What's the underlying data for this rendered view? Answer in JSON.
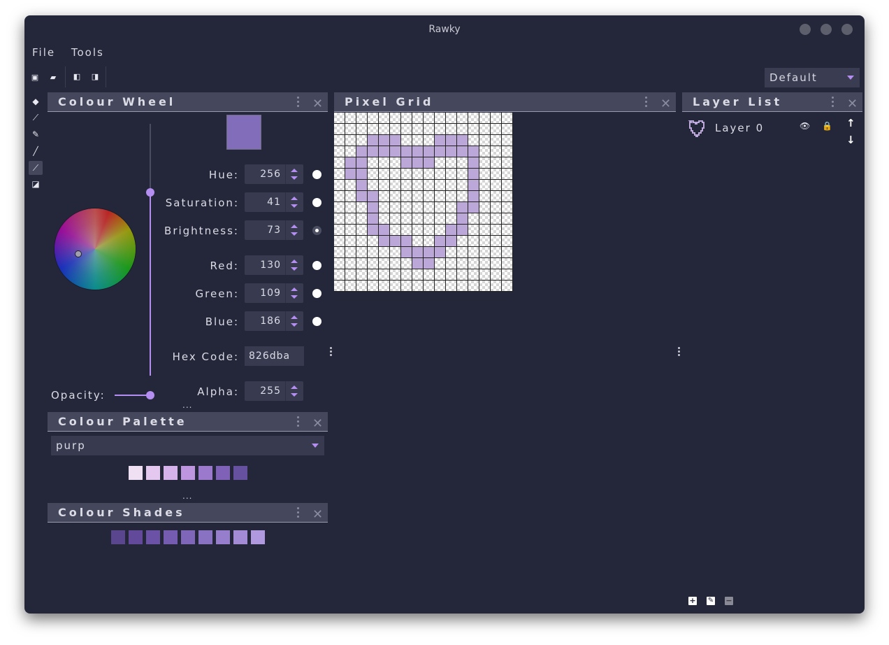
{
  "window": {
    "title": "Rawky"
  },
  "menu": [
    "File",
    "Tools"
  ],
  "toolbar": {
    "layout_select": "Default"
  },
  "colour_wheel": {
    "title": "Colour Wheel",
    "preview_color": "#826dba",
    "fields": [
      {
        "label": "Hue:",
        "value": "256"
      },
      {
        "label": "Saturation:",
        "value": "41"
      },
      {
        "label": "Brightness:",
        "value": "73"
      },
      {
        "label": "Red:",
        "value": "130"
      },
      {
        "label": "Green:",
        "value": "109"
      },
      {
        "label": "Blue:",
        "value": "186"
      }
    ],
    "hex_label": "Hex Code:",
    "hex_value": "826dba",
    "opacity_label": "Opacity:",
    "alpha_label": "Alpha:",
    "alpha_value": "255",
    "more": "..."
  },
  "colour_palette": {
    "title": "Colour Palette",
    "selected": "purp",
    "swatches": [
      "#f0e0f4",
      "#e4c8ef",
      "#d6b2ea",
      "#bd96df",
      "#9b7ace",
      "#7f62b8",
      "#6650a0"
    ],
    "more": "..."
  },
  "colour_shades": {
    "title": "Colour Shades",
    "swatches": [
      "#5a458f",
      "#62499a",
      "#6b52a6",
      "#755cb0",
      "#7f66b8",
      "#8a72c2",
      "#967ecc",
      "#a38bd6",
      "#b199e0"
    ]
  },
  "pixel_grid": {
    "title": "Pixel Grid",
    "cols": 16,
    "rows": 16,
    "filled": [
      [
        3,
        2
      ],
      [
        4,
        2
      ],
      [
        5,
        2
      ],
      [
        9,
        2
      ],
      [
        10,
        2
      ],
      [
        11,
        2
      ],
      [
        2,
        3
      ],
      [
        3,
        3
      ],
      [
        4,
        3
      ],
      [
        5,
        3
      ],
      [
        6,
        3
      ],
      [
        7,
        3
      ],
      [
        8,
        3
      ],
      [
        9,
        3
      ],
      [
        10,
        3
      ],
      [
        11,
        3
      ],
      [
        12,
        3
      ],
      [
        1,
        4
      ],
      [
        2,
        4
      ],
      [
        6,
        4
      ],
      [
        7,
        4
      ],
      [
        8,
        4
      ],
      [
        12,
        4
      ],
      [
        1,
        5
      ],
      [
        2,
        5
      ],
      [
        12,
        5
      ],
      [
        2,
        6
      ],
      [
        12,
        6
      ],
      [
        2,
        7
      ],
      [
        3,
        7
      ],
      [
        12,
        7
      ],
      [
        3,
        8
      ],
      [
        11,
        8
      ],
      [
        12,
        8
      ],
      [
        3,
        9
      ],
      [
        11,
        9
      ],
      [
        3,
        10
      ],
      [
        4,
        10
      ],
      [
        10,
        10
      ],
      [
        11,
        10
      ],
      [
        4,
        11
      ],
      [
        5,
        11
      ],
      [
        6,
        11
      ],
      [
        9,
        11
      ],
      [
        10,
        11
      ],
      [
        6,
        12
      ],
      [
        7,
        12
      ],
      [
        8,
        12
      ],
      [
        9,
        12
      ],
      [
        7,
        13
      ],
      [
        8,
        13
      ]
    ]
  },
  "layer_list": {
    "title": "Layer List",
    "layers": [
      {
        "name": "Layer 0"
      }
    ]
  }
}
